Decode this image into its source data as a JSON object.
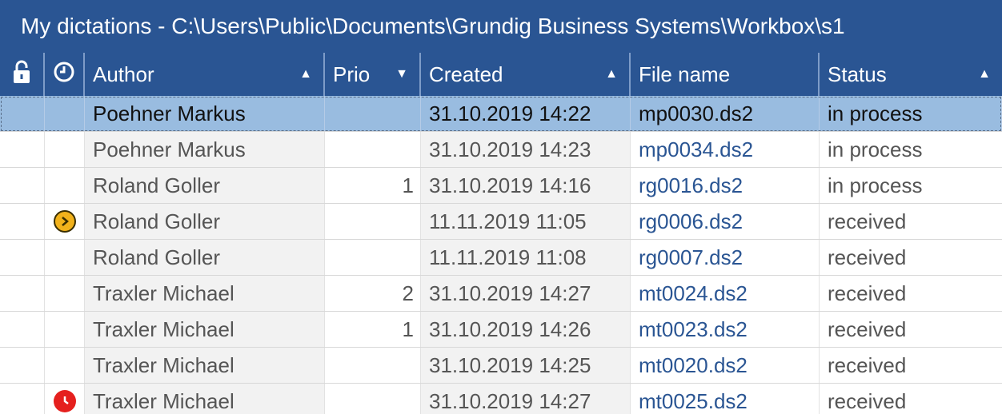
{
  "window": {
    "title": "My dictations - C:\\Users\\Public\\Documents\\Grundig Business Systems\\Workbox\\s1"
  },
  "columns": {
    "lock_icon": "lock-icon",
    "clock_icon": "clock-icon",
    "author": "Author",
    "prio": "Prio",
    "created": "Created",
    "file_name": "File name",
    "status": "Status",
    "author_sort": "▲",
    "prio_sort": "▼",
    "created_sort": "▲",
    "status_sort": "▲"
  },
  "colors": {
    "header_bg": "#2a5593",
    "selected_row": "#99bce0",
    "file_link": "#2a5593",
    "forward_icon": "#f2b21b",
    "alarm_icon": "#e5201e"
  },
  "rows": [
    {
      "author": "Poehner Markus",
      "prio": "",
      "created": "31.10.2019 14:22",
      "file": "mp0030.ds2",
      "status": "in process",
      "icon": ""
    },
    {
      "author": "Poehner Markus",
      "prio": "",
      "created": "31.10.2019 14:23",
      "file": "mp0034.ds2",
      "status": "in process",
      "icon": ""
    },
    {
      "author": "Roland Goller",
      "prio": "1",
      "created": "31.10.2019 14:16",
      "file": "rg0016.ds2",
      "status": "in process",
      "icon": ""
    },
    {
      "author": "Roland Goller",
      "prio": "",
      "created": "11.11.2019 11:05",
      "file": "rg0006.ds2",
      "status": "received",
      "icon": "forward-icon"
    },
    {
      "author": "Roland Goller",
      "prio": "",
      "created": "11.11.2019 11:08",
      "file": "rg0007.ds2",
      "status": "received",
      "icon": ""
    },
    {
      "author": "Traxler Michael",
      "prio": "2",
      "created": "31.10.2019 14:27",
      "file": "mt0024.ds2",
      "status": "received",
      "icon": ""
    },
    {
      "author": "Traxler Michael",
      "prio": "1",
      "created": "31.10.2019 14:26",
      "file": "mt0023.ds2",
      "status": "received",
      "icon": ""
    },
    {
      "author": "Traxler Michael",
      "prio": "",
      "created": "31.10.2019 14:25",
      "file": "mt0020.ds2",
      "status": "received",
      "icon": ""
    },
    {
      "author": "Traxler Michael",
      "prio": "",
      "created": "31.10.2019 14:27",
      "file": "mt0025.ds2",
      "status": "received",
      "icon": "alarm-clock-icon"
    }
  ]
}
